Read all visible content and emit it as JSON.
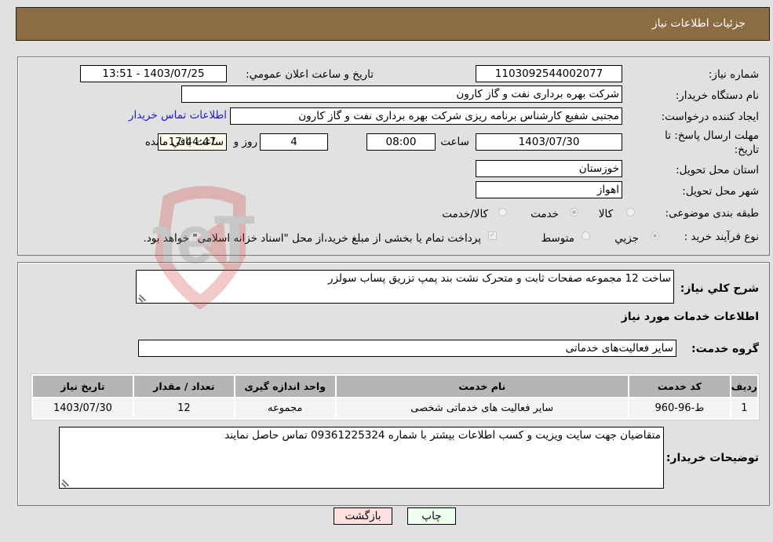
{
  "header": {
    "title": "جزئیات اطلاعات نیاز"
  },
  "form": {
    "need_number_label": "شماره نیاز:",
    "need_number": "1103092544002077",
    "announce_label": "تاریخ و ساعت اعلان عمومي:",
    "announce_value": "1403/07/25 - 13:51",
    "buyer_org_label": "نام دستگاه خریدار:",
    "buyer_org": "شرکت بهره برداری نفت و گاز کارون",
    "requester_label": "ایجاد کننده درخواست:",
    "requester": "مجتبی شفیع کارشناس برنامه ریزی شرکت بهره برداری نفت و گاز کارون",
    "buyer_contact_link": "اطلاعات تماس خریدار",
    "deadline_label_line1": "مهلت ارسال پاسخ: تا",
    "deadline_label_line2": "تاریخ:",
    "deadline_date": "1403/07/30",
    "time_label": "ساعت",
    "deadline_time": "08:00",
    "days_value": "4",
    "days_label": "روز و",
    "remaining_time": "17:44:47",
    "remaining_label": "ساعت باقي مانده",
    "province_label": "استان محل تحویل:",
    "province": "خوزستان",
    "city_label": "شهر محل تحویل:",
    "city": "اهواز",
    "category_label": "طبقه بندی موضوعی:",
    "category_options": [
      {
        "label": "کالا",
        "checked": false
      },
      {
        "label": "خدمت",
        "checked": true
      },
      {
        "label": "کالا/خدمت",
        "checked": false
      }
    ],
    "process_label": "نوع فرآیند خرید :",
    "process_options": [
      {
        "label": "جزيي",
        "checked": true
      },
      {
        "label": "متوسط",
        "checked": false
      }
    ],
    "treasury_checkbox_label": "پرداخت تمام یا بخشی از مبلغ خرید،از محل \"اسناد خزانه اسلامی\" خواهد بود.",
    "treasury_checked": true
  },
  "details": {
    "summary_label": "شرح کلي نیاز:",
    "summary": "ساخت 12 مجموعه صفحات ثابت و متحرک نشت بند پمپ تزریق پساب سولزر",
    "services_heading": "اطلاعات خدمات مورد نیاز",
    "service_group_label": "گروه خدمت:",
    "service_group": "سایر فعالیت‌های خدماتی",
    "table": {
      "headers": [
        "ردیف",
        "کد خدمت",
        "نام خدمت",
        "واحد اندازه گیری",
        "تعداد / مقدار",
        "تاریخ نیاز"
      ],
      "rows": [
        [
          "1",
          "ط-96-960",
          "سایر فعالیت های خدماتی شخصی",
          "مجموعه",
          "12",
          "1403/07/30"
        ]
      ]
    },
    "buyer_notes_label": "توضیحات خریدار:",
    "buyer_notes": "متقاضیان جهت سایت ویزیت و کسب اطلاعات بیشتر با شماره 09361225324 تماس حاصل نمایند"
  },
  "buttons": {
    "print": "چاپ",
    "back": "بازگشت"
  },
  "watermark": {
    "text": "AriaTender.neT"
  }
}
